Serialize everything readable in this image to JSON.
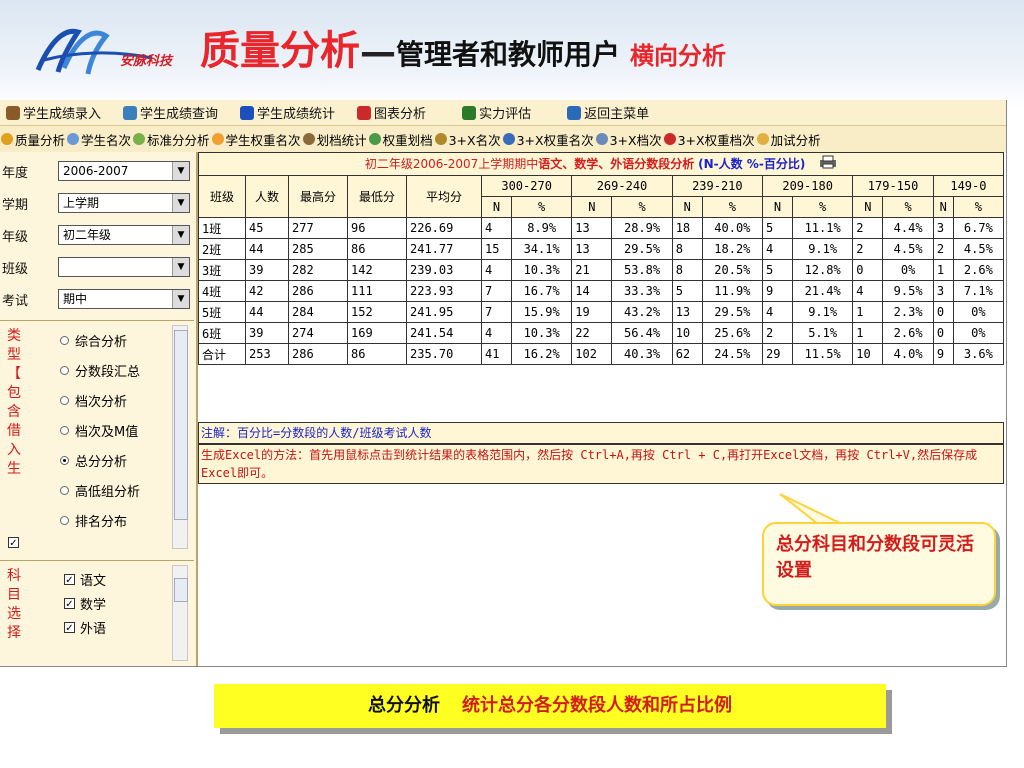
{
  "header": {
    "logo_text": "安脉科技",
    "title_main": "质量分析",
    "title_dash": "—",
    "title_sub": "管理者和教师用户",
    "title_mode": "横向分析"
  },
  "menubar": [
    {
      "label": "学生成绩录入",
      "icon": "edit-icon",
      "color": "#8a5a2a"
    },
    {
      "label": "学生成绩查询",
      "icon": "query-icon",
      "color": "#3c7fbd"
    },
    {
      "label": "学生成绩统计",
      "icon": "bar-chart-icon",
      "color": "#1e4fbf"
    },
    {
      "label": "图表分析",
      "icon": "pie-chart-icon",
      "color": "#cc2a2a"
    },
    {
      "label": "实力评估",
      "icon": "evaluate-icon",
      "color": "#2a7a2a"
    },
    {
      "label": "返回主菜单",
      "icon": "grid-menu-icon",
      "color": "#2a6ab8"
    }
  ],
  "toolbar": [
    {
      "label": "质量分析",
      "icon": "quality-icon",
      "color": "#e0a020"
    },
    {
      "label": "学生名次",
      "icon": "rank-icon",
      "color": "#6a9ad4"
    },
    {
      "label": "标准分分析",
      "icon": "standard-icon",
      "color": "#7ab04a"
    },
    {
      "label": "学生权重名次",
      "icon": "weight-rank-icon",
      "color": "#f0a030"
    },
    {
      "label": "划档统计",
      "icon": "band-icon",
      "color": "#8a6a3a"
    },
    {
      "label": "权重划档",
      "icon": "weight-band-icon",
      "color": "#4a9a4a"
    },
    {
      "label": "3+X名次",
      "icon": "3x-rank-icon",
      "color": "#b08a2a"
    },
    {
      "label": "3+X权重名次",
      "icon": "3x-weight-rank-icon",
      "color": "#3a6ab8"
    },
    {
      "label": "3+X档次",
      "icon": "3x-level-icon",
      "color": "#6a8ab8"
    },
    {
      "label": "3+X权重档次",
      "icon": "3x-weight-level-icon",
      "color": "#cc2a2a"
    },
    {
      "label": "加试分析",
      "icon": "extra-exam-icon",
      "color": "#e0b040"
    }
  ],
  "filters": {
    "year": {
      "label": "年度",
      "value": "2006-2007"
    },
    "term": {
      "label": "学期",
      "value": "上学期"
    },
    "grade": {
      "label": "年级",
      "value": "初二年级"
    },
    "class": {
      "label": "班级",
      "value": ""
    },
    "exam": {
      "label": "考试",
      "value": "期中"
    }
  },
  "type_group": {
    "label_chars": [
      "类",
      "型",
      "【",
      "包",
      "含",
      "借",
      "入",
      "生"
    ],
    "checkbox_checked": true,
    "options": [
      {
        "label": "综合分析",
        "selected": false
      },
      {
        "label": "分数段汇总",
        "selected": false
      },
      {
        "label": "档次分析",
        "selected": false
      },
      {
        "label": "档次及M值",
        "selected": false
      },
      {
        "label": "总分分析",
        "selected": true
      },
      {
        "label": "高低组分析",
        "selected": false
      },
      {
        "label": "排名分布",
        "selected": false
      }
    ]
  },
  "subject_group": {
    "label_chars": [
      "科",
      "目",
      "选",
      "择"
    ],
    "options": [
      {
        "label": "语文",
        "checked": true
      },
      {
        "label": "数学",
        "checked": true
      },
      {
        "label": "外语",
        "checked": true
      }
    ]
  },
  "table": {
    "title_prefix": "初二年级2006-2007上学期期中",
    "title_subjects": "语文、数学、外语分数段分析",
    "title_unit": "(N-人数 %-百分比)",
    "headers": [
      "班级",
      "人数",
      "最高分",
      "最低分",
      "平均分"
    ],
    "bands": [
      "300-270",
      "269-240",
      "239-210",
      "209-180",
      "179-150",
      "149-0"
    ],
    "sub_headers": [
      "N",
      "%"
    ],
    "rows": [
      {
        "cls": "1班",
        "count": "45",
        "max": "277",
        "min": "96",
        "avg": "226.69",
        "bands": [
          [
            "4",
            "8.9%"
          ],
          [
            "13",
            "28.9%"
          ],
          [
            "18",
            "40.0%"
          ],
          [
            "5",
            "11.1%"
          ],
          [
            "2",
            "4.4%"
          ],
          [
            "3",
            "6.7%"
          ]
        ]
      },
      {
        "cls": "2班",
        "count": "44",
        "max": "285",
        "min": "86",
        "avg": "241.77",
        "bands": [
          [
            "15",
            "34.1%"
          ],
          [
            "13",
            "29.5%"
          ],
          [
            "8",
            "18.2%"
          ],
          [
            "4",
            "9.1%"
          ],
          [
            "2",
            "4.5%"
          ],
          [
            "2",
            "4.5%"
          ]
        ]
      },
      {
        "cls": "3班",
        "count": "39",
        "max": "282",
        "min": "142",
        "avg": "239.03",
        "bands": [
          [
            "4",
            "10.3%"
          ],
          [
            "21",
            "53.8%"
          ],
          [
            "8",
            "20.5%"
          ],
          [
            "5",
            "12.8%"
          ],
          [
            "0",
            "0%"
          ],
          [
            "1",
            "2.6%"
          ]
        ]
      },
      {
        "cls": "4班",
        "count": "42",
        "max": "286",
        "min": "111",
        "avg": "223.93",
        "bands": [
          [
            "7",
            "16.7%"
          ],
          [
            "14",
            "33.3%"
          ],
          [
            "5",
            "11.9%"
          ],
          [
            "9",
            "21.4%"
          ],
          [
            "4",
            "9.5%"
          ],
          [
            "3",
            "7.1%"
          ]
        ]
      },
      {
        "cls": "5班",
        "count": "44",
        "max": "284",
        "min": "152",
        "avg": "241.95",
        "bands": [
          [
            "7",
            "15.9%"
          ],
          [
            "19",
            "43.2%"
          ],
          [
            "13",
            "29.5%"
          ],
          [
            "4",
            "9.1%"
          ],
          [
            "1",
            "2.3%"
          ],
          [
            "0",
            "0%"
          ]
        ]
      },
      {
        "cls": "6班",
        "count": "39",
        "max": "274",
        "min": "169",
        "avg": "241.54",
        "bands": [
          [
            "4",
            "10.3%"
          ],
          [
            "22",
            "56.4%"
          ],
          [
            "10",
            "25.6%"
          ],
          [
            "2",
            "5.1%"
          ],
          [
            "1",
            "2.6%"
          ],
          [
            "0",
            "0%"
          ]
        ]
      },
      {
        "cls": "合计",
        "count": "253",
        "max": "286",
        "min": "86",
        "avg": "235.70",
        "bands": [
          [
            "41",
            "16.2%"
          ],
          [
            "102",
            "40.3%"
          ],
          [
            "62",
            "24.5%"
          ],
          [
            "29",
            "11.5%"
          ],
          [
            "10",
            "4.0%"
          ],
          [
            "9",
            "3.6%"
          ]
        ]
      }
    ],
    "note1": "注解：百分比=分数段的人数/班级考试人数",
    "note2": "生成Excel的方法：首先用鼠标点击到统计结果的表格范围内，然后按 Ctrl+A,再按 Ctrl + C,再打开Excel文档，再按 Ctrl+V,然后保存成Excel即可。"
  },
  "callout": {
    "text": "总分科目和分数段可灵活设置"
  },
  "caption": {
    "part1": "总分分析",
    "part2": "统计总分各分数段人数和所占比例"
  }
}
